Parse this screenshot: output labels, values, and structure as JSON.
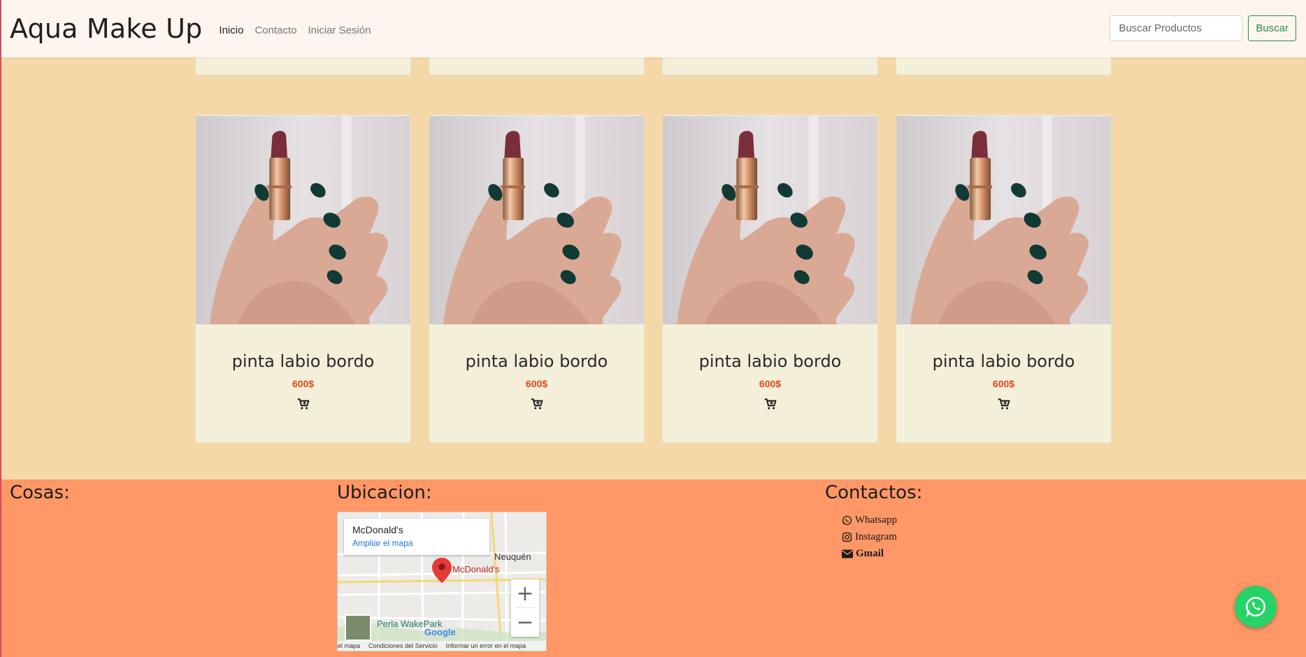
{
  "navbar": {
    "brand": "Aqua Make Up",
    "links": [
      "Inicio",
      "Contacto",
      "Iniciar Sesión"
    ],
    "search_placeholder": "Buscar Productos",
    "search_button": "Buscar"
  },
  "products": [
    {
      "name": "pinta labio bordo",
      "price": "600$"
    },
    {
      "name": "pinta labio bordo",
      "price": "600$"
    },
    {
      "name": "pinta labio bordo",
      "price": "600$"
    },
    {
      "name": "pinta labio bordo",
      "price": "600$"
    }
  ],
  "footer": {
    "cosas_title": "Cosas:",
    "ubicacion_title": "Ubicacion:",
    "contactos_title": "Contactos:",
    "map": {
      "place_name": "McDonald's",
      "expand_link": "Ampliar el mapa",
      "city_label": "Neuquén",
      "marker_label": "McDonald's",
      "park_label": "Perla WakePark",
      "google_label": "Google",
      "bottom_links": [
        "el mapa",
        "Condiciones del Servicio",
        "Informar un error en el mapa"
      ]
    },
    "contacts": [
      "Whatsapp",
      "Instagram",
      "Gmail"
    ]
  },
  "colors": {
    "page_bg": "#f5d8a8",
    "navbar_bg": "#fdf5ee",
    "card_bg": "#f3efd9",
    "price": "#e8441c",
    "footer_bg": "#ff9766",
    "whatsapp": "#25d366",
    "search_button": "#2e8a4a"
  }
}
